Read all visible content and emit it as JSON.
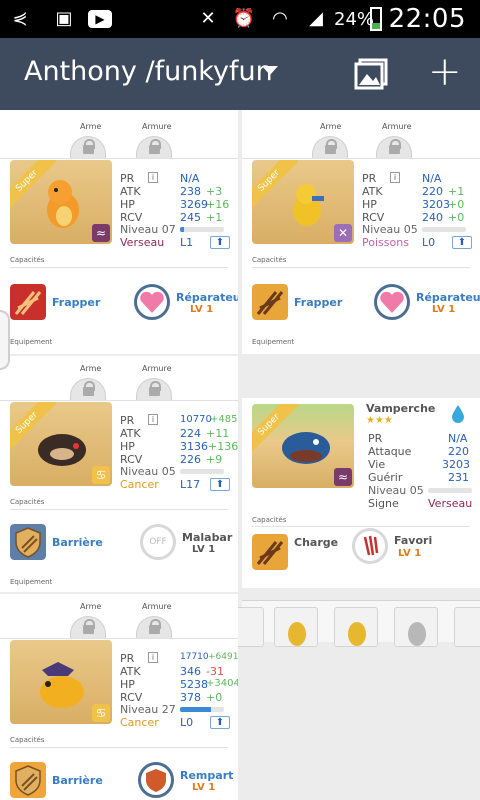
{
  "status": {
    "time": "22:05",
    "battery_pct": "24%"
  },
  "appbar": {
    "title": "Anthony /funkyfun",
    "dropdown_icon": "chevron-down-icon",
    "gallery_icon": "image-icon",
    "add_icon": "plus-icon"
  },
  "labels": {
    "arme": "Arme",
    "armure": "Armure",
    "capacites": "Capacités",
    "equipement": "Equipement",
    "pr": "PR",
    "atk": "ATK",
    "hp": "HP",
    "rcv": "RCV",
    "attaque": "Attaque",
    "vie": "Vie",
    "guerir": "Guérir",
    "signe": "Signe",
    "super": "Super",
    "info": "i"
  },
  "colors": {
    "appbar": "#3e4a5e",
    "statusbar": "#000000",
    "skill_blue": "#3a7cc0",
    "level_orange": "#e27a1a"
  },
  "cards": [
    {
      "pr": "N/A",
      "atk": "238",
      "atk_bonus": "+3",
      "hp": "3269",
      "hp_bonus": "+16",
      "rcv": "245",
      "rcv_bonus": "+1",
      "level": "Niveau 07",
      "level_fill": 0.1,
      "sign": "Verseau",
      "lvl": "L1",
      "skill1": "Frapper",
      "skill2": "Réparateur",
      "skill2_lv": "LV 1"
    },
    {
      "pr": "N/A",
      "atk": "220",
      "atk_bonus": "+1",
      "hp": "3203",
      "hp_bonus": "+0",
      "rcv": "240",
      "rcv_bonus": "+0",
      "level": "Niveau 05",
      "level_fill": 0.0,
      "sign": "Poissons",
      "lvl": "L0",
      "skill1": "Frapper",
      "skill2": "Réparateur",
      "skill2_lv": "LV 1"
    },
    {
      "pr": "10770",
      "pr_bonus": "+485",
      "atk": "224",
      "atk_bonus": "+11",
      "hp": "3136",
      "hp_bonus": "+136",
      "rcv": "226",
      "rcv_bonus": "+9",
      "level": "Niveau 05",
      "level_fill": 0.0,
      "sign": "Cancer",
      "lvl": "L17",
      "skill1": "Barrière",
      "skill2": "Malabar",
      "skill2_lv": "LV 1",
      "off": "OFF"
    },
    {
      "name": "Vamperche",
      "stars": "★★★",
      "pr": "N/A",
      "atk": "220",
      "hp": "3203",
      "rcv": "231",
      "level": "Niveau 05",
      "level_fill": 0.0,
      "sign": "Verseau",
      "skill1": "Charge",
      "skill2": "Favori",
      "skill2_lv": "LV 1"
    },
    {
      "pr": "17710",
      "pr_bonus": "+6491",
      "atk": "346",
      "atk_bonus": "-31",
      "hp": "5238",
      "hp_bonus": "+3404",
      "rcv": "378",
      "rcv_bonus": "+0",
      "level": "Niveau 27",
      "level_fill": 0.7,
      "sign": "Cancer",
      "lvl": "L0",
      "skill1": "Barrière",
      "skill2": "Rempart",
      "skill2_lv": "LV 1"
    }
  ]
}
